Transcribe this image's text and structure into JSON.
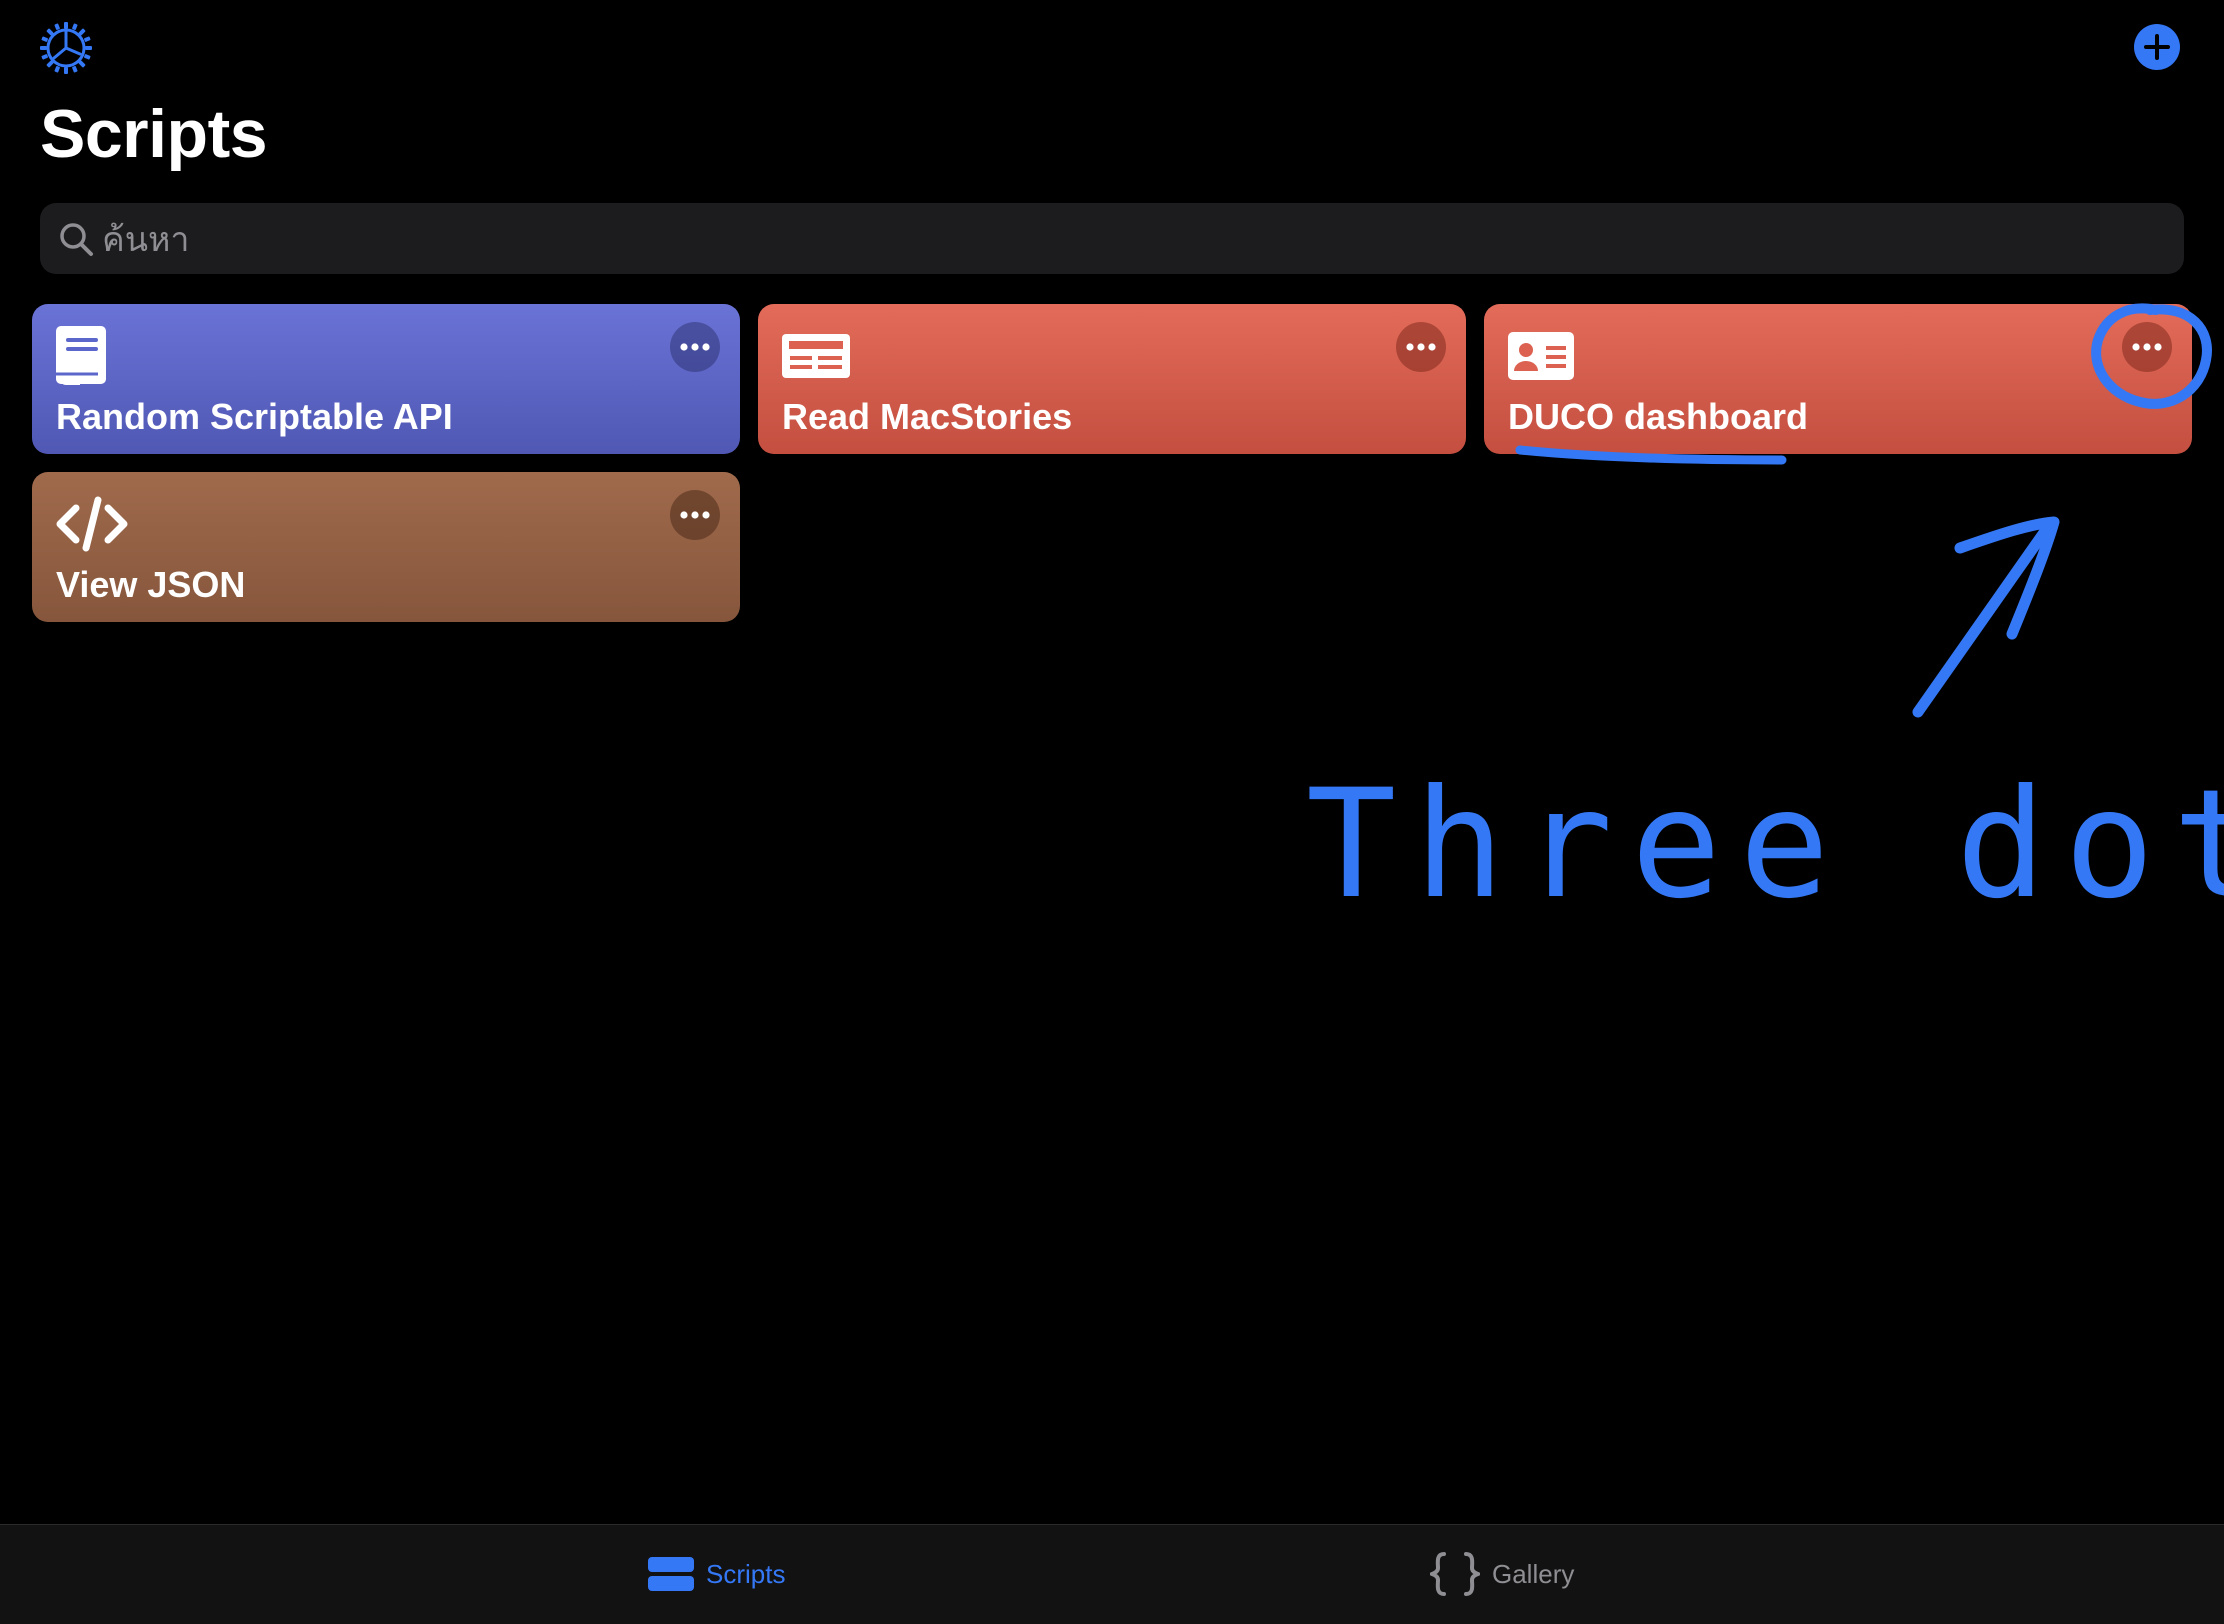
{
  "header": {
    "title": "Scripts",
    "settings_icon": "gear-icon",
    "add_icon": "plus-circle-icon",
    "accent_color": "#3478f6"
  },
  "search": {
    "placeholder": "ค้นหา",
    "value": ""
  },
  "scripts": [
    {
      "title": "Random Scriptable API",
      "icon": "book-icon",
      "color": "#5c67cc"
    },
    {
      "title": "Read MacStories",
      "icon": "newspaper-icon",
      "color": "#dc6150"
    },
    {
      "title": "DUCO dashboard",
      "icon": "contact-card-icon",
      "color": "#dc6150"
    },
    {
      "title": "View JSON",
      "icon": "code-icon",
      "color": "#9a6142"
    }
  ],
  "annotation": {
    "text": "Three dot",
    "color": "#3478f6"
  },
  "tab_bar": {
    "tabs": [
      {
        "label": "Scripts",
        "icon": "list-icon",
        "active": true
      },
      {
        "label": "Gallery",
        "icon": "braces-icon",
        "active": false
      }
    ],
    "active_color": "#3478f6",
    "inactive_color": "#8e8e93"
  }
}
